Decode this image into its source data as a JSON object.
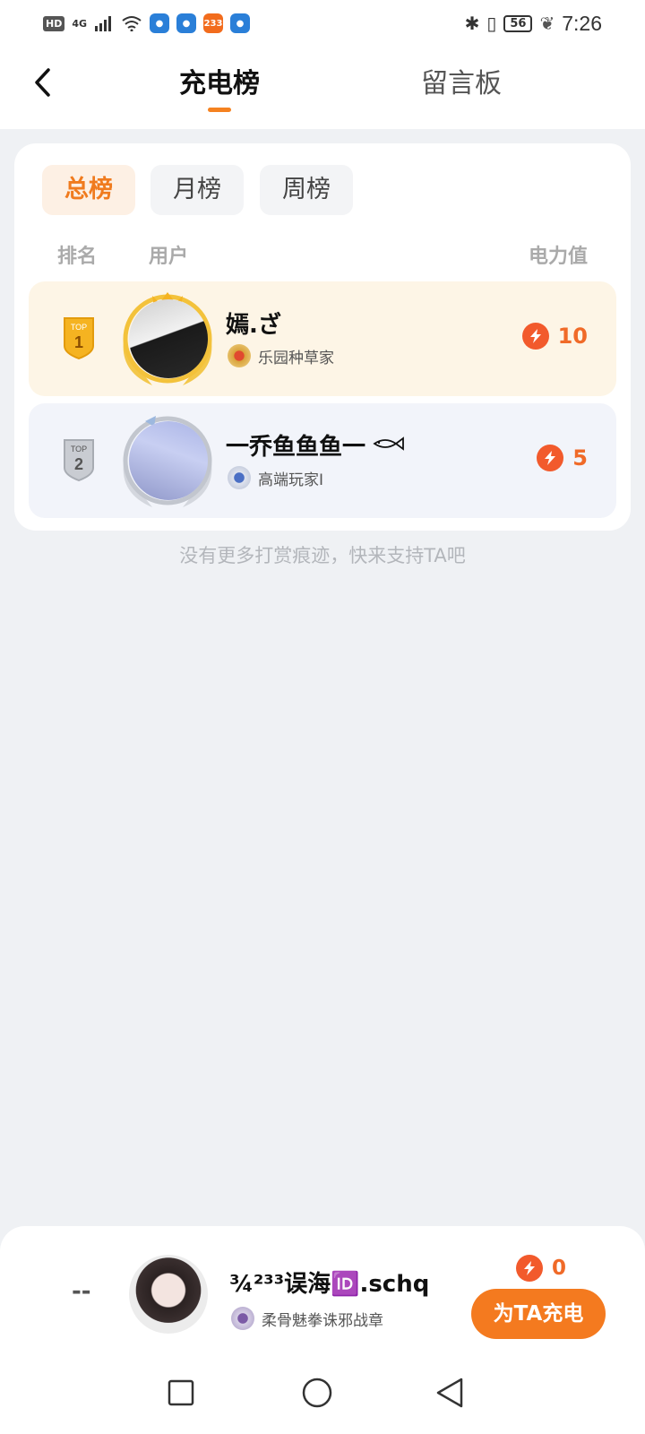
{
  "status_bar": {
    "hd": "HD",
    "network": "4G",
    "app_badge": "233",
    "battery": "56",
    "time": "7:26"
  },
  "header": {
    "tabs": [
      {
        "label": "充电榜",
        "active": true
      },
      {
        "label": "留言板",
        "active": false
      }
    ]
  },
  "filters": [
    {
      "label": "总榜",
      "active": true
    },
    {
      "label": "月榜",
      "active": false
    },
    {
      "label": "周榜",
      "active": false
    }
  ],
  "columns": {
    "rank": "排名",
    "user": "用户",
    "power": "电力值"
  },
  "rankings": [
    {
      "rank_badge": "TOP",
      "rank": "1",
      "name": "嫣.ざ",
      "medal": "乐园种草家",
      "power": "10"
    },
    {
      "rank_badge": "TOP",
      "rank": "2",
      "name": "一乔鱼鱼鱼一",
      "medal": "高端玩家I",
      "power": "5"
    }
  ],
  "empty_tip": "没有更多打赏痕迹，快来支持TA吧",
  "me": {
    "rank": "--",
    "name": "¾²³³误海🆔.schq",
    "medal": "柔骨魅拳诛邪战章",
    "power": "0",
    "charge_button": "为TA充电"
  },
  "colors": {
    "accent": "#f47a1f",
    "power": "#f06a28",
    "bg": "#eff1f4"
  }
}
